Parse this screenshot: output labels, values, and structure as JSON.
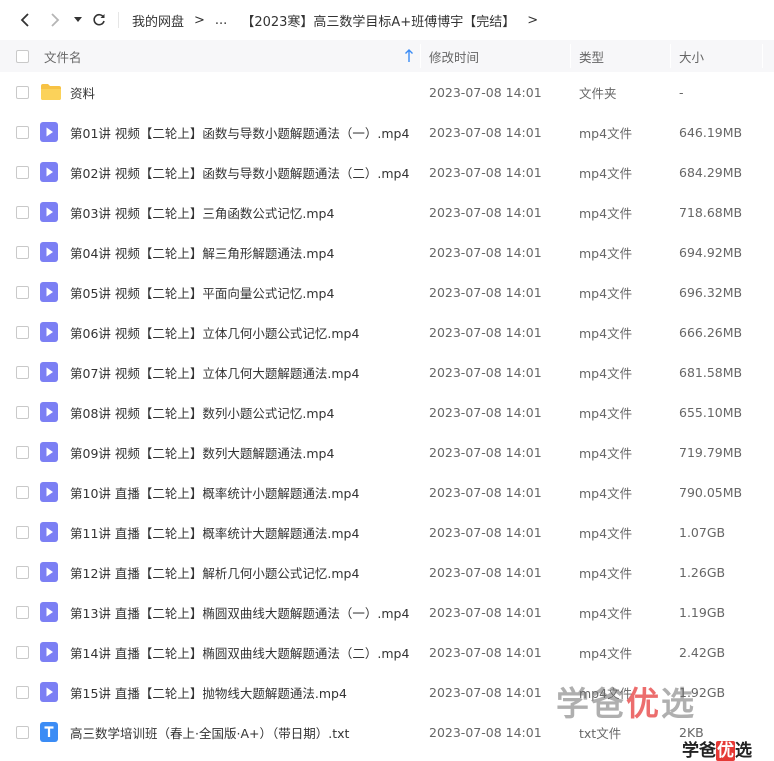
{
  "nav": {
    "back_icon": "chevron-left-icon",
    "forward_icon": "chevron-right-icon",
    "history_icon": "caret-down-icon",
    "refresh_icon": "refresh-icon",
    "breadcrumbs": [
      "我的网盘",
      "...",
      "【2023寒】高三数学目标A+班傅博宇【完结】"
    ],
    "separator": ">"
  },
  "columns": {
    "name": "文件名",
    "modified": "修改时间",
    "type": "类型",
    "size": "大小"
  },
  "colors": {
    "video_icon": "#7b7ff4",
    "folder_icon": "#f7c244",
    "txt_icon": "#3b8cf5",
    "header_bg": "#f7f7f9"
  },
  "files": [
    {
      "name": "资料",
      "date": "2023-07-08 14:01",
      "type": "文件夹",
      "size": "-",
      "icon": "folder-icon"
    },
    {
      "name": "第01讲 视频【二轮上】函数与导数小题解题通法（一）.mp4",
      "date": "2023-07-08 14:01",
      "type": "mp4文件",
      "size": "646.19MB",
      "icon": "video-file-icon"
    },
    {
      "name": "第02讲 视频【二轮上】函数与导数小题解题通法（二）.mp4",
      "date": "2023-07-08 14:01",
      "type": "mp4文件",
      "size": "684.29MB",
      "icon": "video-file-icon"
    },
    {
      "name": "第03讲 视频【二轮上】三角函数公式记忆.mp4",
      "date": "2023-07-08 14:01",
      "type": "mp4文件",
      "size": "718.68MB",
      "icon": "video-file-icon"
    },
    {
      "name": "第04讲 视频【二轮上】解三角形解题通法.mp4",
      "date": "2023-07-08 14:01",
      "type": "mp4文件",
      "size": "694.92MB",
      "icon": "video-file-icon"
    },
    {
      "name": "第05讲 视频【二轮上】平面向量公式记忆.mp4",
      "date": "2023-07-08 14:01",
      "type": "mp4文件",
      "size": "696.32MB",
      "icon": "video-file-icon"
    },
    {
      "name": "第06讲 视频【二轮上】立体几何小题公式记忆.mp4",
      "date": "2023-07-08 14:01",
      "type": "mp4文件",
      "size": "666.26MB",
      "icon": "video-file-icon"
    },
    {
      "name": "第07讲 视频【二轮上】立体几何大题解题通法.mp4",
      "date": "2023-07-08 14:01",
      "type": "mp4文件",
      "size": "681.58MB",
      "icon": "video-file-icon"
    },
    {
      "name": "第08讲 视频【二轮上】数列小题公式记忆.mp4",
      "date": "2023-07-08 14:01",
      "type": "mp4文件",
      "size": "655.10MB",
      "icon": "video-file-icon"
    },
    {
      "name": "第09讲 视频【二轮上】数列大题解题通法.mp4",
      "date": "2023-07-08 14:01",
      "type": "mp4文件",
      "size": "719.79MB",
      "icon": "video-file-icon"
    },
    {
      "name": "第10讲 直播【二轮上】概率统计小题解题通法.mp4",
      "date": "2023-07-08 14:01",
      "type": "mp4文件",
      "size": "790.05MB",
      "icon": "video-file-icon"
    },
    {
      "name": "第11讲 直播【二轮上】概率统计大题解题通法.mp4",
      "date": "2023-07-08 14:01",
      "type": "mp4文件",
      "size": "1.07GB",
      "icon": "video-file-icon"
    },
    {
      "name": "第12讲 直播【二轮上】解析几何小题公式记忆.mp4",
      "date": "2023-07-08 14:01",
      "type": "mp4文件",
      "size": "1.26GB",
      "icon": "video-file-icon"
    },
    {
      "name": "第13讲 直播【二轮上】椭圆双曲线大题解题通法（一）.mp4",
      "date": "2023-07-08 14:01",
      "type": "mp4文件",
      "size": "1.19GB",
      "icon": "video-file-icon"
    },
    {
      "name": "第14讲 直播【二轮上】椭圆双曲线大题解题通法（二）.mp4",
      "date": "2023-07-08 14:01",
      "type": "mp4文件",
      "size": "2.42GB",
      "icon": "video-file-icon"
    },
    {
      "name": "第15讲 直播【二轮上】抛物线大题解题通法.mp4",
      "date": "2023-07-08 14:01",
      "type": "mp4文件",
      "size": "1.92GB",
      "icon": "video-file-icon"
    },
    {
      "name": "高三数学培训班（春上·全国版·A+）（带日期）.txt",
      "date": "2023-07-08 14:01",
      "type": "txt文件",
      "size": "2KB",
      "icon": "txt-file-icon"
    }
  ],
  "watermark": {
    "big_gray": "学爸",
    "big_red": "优",
    "big_gray2": "选",
    "small_gray": "学爸",
    "small_red": "优",
    "small_gray2": "选"
  }
}
